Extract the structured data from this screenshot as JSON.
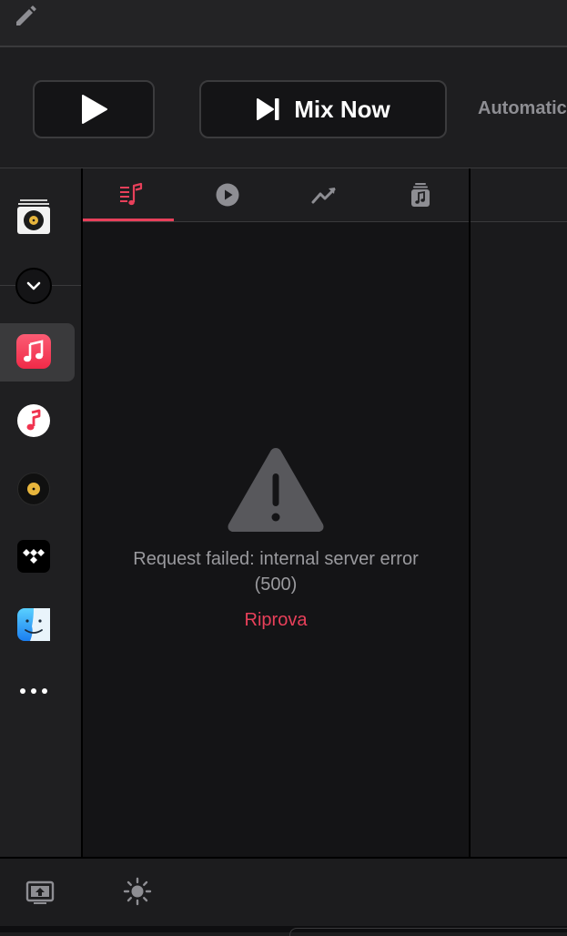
{
  "toolbar": {
    "edit_icon": "pencil-icon",
    "play_icon": "play-icon",
    "mix_now_label": "Mix Now",
    "mix_now_icon": "play-next-icon",
    "automatic_label": "Automatic"
  },
  "sidebar": {
    "items": [
      {
        "name": "vinyl-box-app",
        "icon": "vinyl-box-icon"
      },
      {
        "name": "collapse",
        "icon": "chevron-down-icon"
      },
      {
        "name": "apple-music",
        "icon": "apple-music-icon",
        "selected": true
      },
      {
        "name": "music-white",
        "icon": "music-note-icon"
      },
      {
        "name": "local-vinyl",
        "icon": "vinyl-icon"
      },
      {
        "name": "tidal",
        "icon": "tidal-icon"
      },
      {
        "name": "finder",
        "icon": "finder-icon"
      },
      {
        "name": "more",
        "icon": "more-icon"
      }
    ]
  },
  "tabs": [
    {
      "name": "tab-queue",
      "icon": "queue-icon",
      "active": true
    },
    {
      "name": "tab-playing",
      "icon": "play-circle-icon"
    },
    {
      "name": "tab-trending",
      "icon": "trend-icon"
    },
    {
      "name": "tab-library",
      "icon": "music-library-icon"
    }
  ],
  "error": {
    "icon": "warning-icon",
    "message": "Request failed: internal server error (500)",
    "retry_label": "Riprova"
  },
  "bottombar": {
    "screen_icon": "screen-share-icon",
    "brightness_icon": "sun-icon"
  },
  "colors": {
    "accent": "#e8405a",
    "background": "#1c1c1e",
    "content_bg": "#141416",
    "muted_text": "#9a9a9e"
  }
}
